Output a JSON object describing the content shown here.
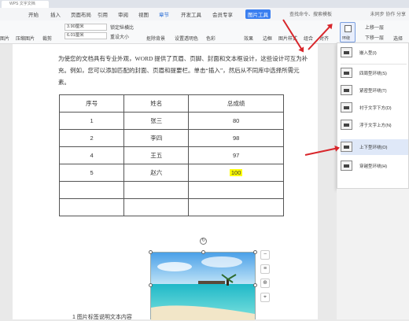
{
  "titlebar": {
    "tab_title": "WPS 文字文档"
  },
  "menubar": {
    "items": [
      "开始",
      "插入",
      "页面布局",
      "引用",
      "审阅",
      "视图",
      "章节",
      "开发工具",
      "会员专享"
    ],
    "picture_tool": "图片工具",
    "search": "查找命令、搜索模板",
    "right": "未同步  协作  分享"
  },
  "toolbar": {
    "height_value": "3.90厘米",
    "width_value": "6.01厘米",
    "lock_ratio": "锁定纵横比",
    "reset_size": "重设大小",
    "labels": [
      "图片",
      "压缩图片",
      "裁剪",
      "抠除背景",
      "设置透明色",
      "色彩",
      "效果",
      "边框",
      "图片样式",
      "组合",
      "对齐",
      "旋转",
      "环绕",
      "上移一层",
      "下移一层",
      "选择"
    ],
    "wrap_button": "环绕"
  },
  "document": {
    "paragraph": "为使您的文档具有专业外观，WORD 提供了页眉、页脚、封面和文本框设计，这些设计可互为补充。例如，您可以添加匹配的封面、页眉和提要栏。单击“插入”，然后从不同库中选择所需元素。",
    "table": {
      "headers": [
        "序号",
        "姓名",
        "总成绩"
      ],
      "rows": [
        [
          "1",
          "张三",
          "80"
        ],
        [
          "2",
          "李四",
          "98"
        ],
        [
          "4",
          "王五",
          "97"
        ],
        [
          "5",
          "赵六",
          "100"
        ],
        [
          "",
          "",
          ""
        ],
        [
          "",
          "",
          ""
        ]
      ]
    },
    "caption": "1  图片标签说明文本内容"
  },
  "wrap_menu": {
    "items": [
      "嵌入型(I)",
      "四周型环绕(S)",
      "紧密型环绕(T)",
      "衬于文字下方(D)",
      "浮于文字上方(N)",
      "上下型环绕(O)",
      "穿越型环绕(H)"
    ],
    "hovered_index": 5
  },
  "colors": {
    "accent": "#3a7ff0",
    "arrow": "#d8262b",
    "highlight": "#ffff00"
  }
}
